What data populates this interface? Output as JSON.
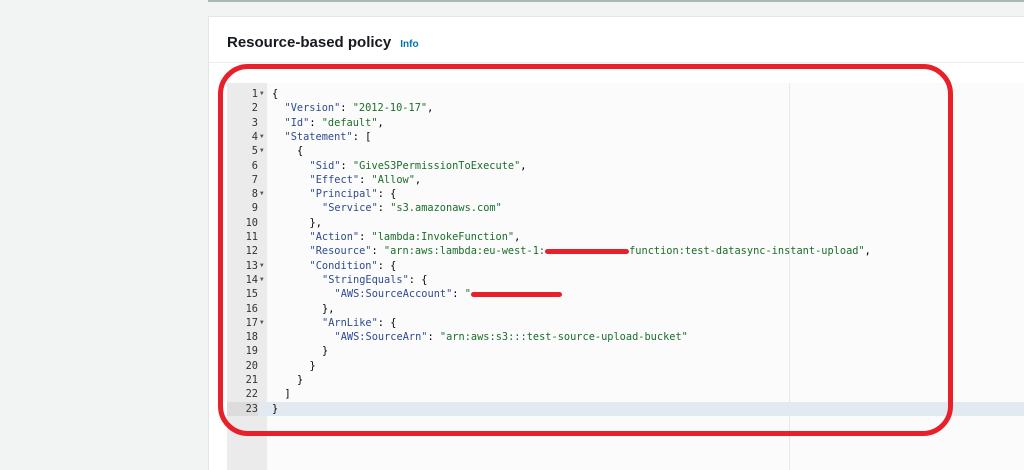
{
  "header": {
    "title": "Resource-based policy",
    "info_link": "Info"
  },
  "editor": {
    "active_line": 23,
    "lines": [
      {
        "n": 1,
        "fold": true,
        "indent": 0,
        "parts": [
          [
            "p",
            "{"
          ]
        ]
      },
      {
        "n": 2,
        "indent": 1,
        "parts": [
          [
            "k",
            "\"Version\""
          ],
          [
            "p",
            ": "
          ],
          [
            "s",
            "\"2012-10-17\""
          ],
          [
            "p",
            ","
          ]
        ]
      },
      {
        "n": 3,
        "indent": 1,
        "parts": [
          [
            "k",
            "\"Id\""
          ],
          [
            "p",
            ": "
          ],
          [
            "s",
            "\"default\""
          ],
          [
            "p",
            ","
          ]
        ]
      },
      {
        "n": 4,
        "fold": true,
        "indent": 1,
        "parts": [
          [
            "k",
            "\"Statement\""
          ],
          [
            "p",
            ": ["
          ]
        ]
      },
      {
        "n": 5,
        "fold": true,
        "indent": 2,
        "parts": [
          [
            "p",
            "{"
          ]
        ]
      },
      {
        "n": 6,
        "indent": 3,
        "parts": [
          [
            "k",
            "\"Sid\""
          ],
          [
            "p",
            ": "
          ],
          [
            "s",
            "\"GiveS3PermissionToExecute\""
          ],
          [
            "p",
            ","
          ]
        ]
      },
      {
        "n": 7,
        "indent": 3,
        "parts": [
          [
            "k",
            "\"Effect\""
          ],
          [
            "p",
            ": "
          ],
          [
            "s",
            "\"Allow\""
          ],
          [
            "p",
            ","
          ]
        ]
      },
      {
        "n": 8,
        "fold": true,
        "indent": 3,
        "parts": [
          [
            "k",
            "\"Principal\""
          ],
          [
            "p",
            ": {"
          ]
        ]
      },
      {
        "n": 9,
        "indent": 4,
        "parts": [
          [
            "k",
            "\"Service\""
          ],
          [
            "p",
            ": "
          ],
          [
            "s",
            "\"s3.amazonaws.com\""
          ]
        ]
      },
      {
        "n": 10,
        "indent": 3,
        "parts": [
          [
            "p",
            "},"
          ]
        ]
      },
      {
        "n": 11,
        "indent": 3,
        "parts": [
          [
            "k",
            "\"Action\""
          ],
          [
            "p",
            ": "
          ],
          [
            "s",
            "\"lambda:InvokeFunction\""
          ],
          [
            "p",
            ","
          ]
        ]
      },
      {
        "n": 12,
        "indent": 3,
        "parts": [
          [
            "k",
            "\"Resource\""
          ],
          [
            "p",
            ": "
          ],
          [
            "s",
            "\"arn:aws:lambda:eu-west-1:"
          ],
          [
            "r",
            "12"
          ],
          [
            "s",
            "function:test-datasync-instant-upload\""
          ],
          [
            "p",
            ","
          ]
        ]
      },
      {
        "n": 13,
        "fold": true,
        "indent": 3,
        "parts": [
          [
            "k",
            "\"Condition\""
          ],
          [
            "p",
            ": {"
          ]
        ]
      },
      {
        "n": 14,
        "fold": true,
        "indent": 4,
        "parts": [
          [
            "k",
            "\"StringEquals\""
          ],
          [
            "p",
            ": {"
          ]
        ]
      },
      {
        "n": 15,
        "indent": 5,
        "parts": [
          [
            "k",
            "\"AWS:SourceAccount\""
          ],
          [
            "p",
            ": "
          ],
          [
            "s",
            "\""
          ],
          [
            "r",
            "13"
          ]
        ]
      },
      {
        "n": 16,
        "indent": 4,
        "parts": [
          [
            "p",
            "},"
          ]
        ]
      },
      {
        "n": 17,
        "fold": true,
        "indent": 4,
        "parts": [
          [
            "k",
            "\"ArnLike\""
          ],
          [
            "p",
            ": {"
          ]
        ]
      },
      {
        "n": 18,
        "indent": 5,
        "parts": [
          [
            "k",
            "\"AWS:SourceArn\""
          ],
          [
            "p",
            ": "
          ],
          [
            "s",
            "\"arn:aws:s3:::test-source-upload-bucket\""
          ]
        ]
      },
      {
        "n": 19,
        "indent": 4,
        "parts": [
          [
            "p",
            "}"
          ]
        ]
      },
      {
        "n": 20,
        "indent": 3,
        "parts": [
          [
            "p",
            "}"
          ]
        ]
      },
      {
        "n": 21,
        "indent": 2,
        "parts": [
          [
            "p",
            "}"
          ]
        ]
      },
      {
        "n": 22,
        "indent": 1,
        "parts": [
          [
            "p",
            "]"
          ]
        ]
      },
      {
        "n": 23,
        "indent": 0,
        "parts": [
          [
            "p",
            "}"
          ]
        ]
      }
    ]
  },
  "colors": {
    "annotation": "#e8202a",
    "info": "#0073bb"
  }
}
